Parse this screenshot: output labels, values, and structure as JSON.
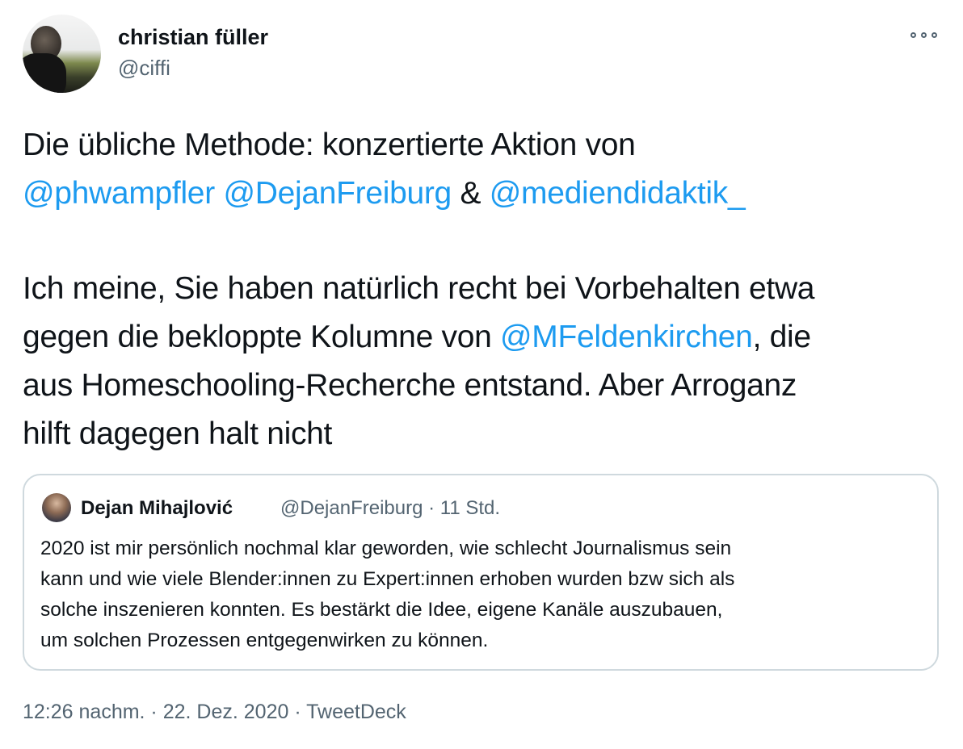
{
  "author": {
    "name": "christian füller",
    "handle": "@ciffi"
  },
  "tweet": {
    "lines": [
      [
        {
          "t": "Die übliche Methode: konzertierte Aktion von"
        }
      ],
      [
        {
          "t": "@phwampfler",
          "m": true
        },
        {
          "t": " "
        },
        {
          "t": "@DejanFreiburg",
          "m": true
        },
        {
          "t": " & "
        },
        {
          "t": "@mediendidaktik_",
          "m": true
        }
      ],
      [],
      [
        {
          "t": "Ich meine, Sie haben natürlich recht bei Vorbehalten etwa"
        }
      ],
      [
        {
          "t": "gegen die bekloppte Kolumne von "
        },
        {
          "t": "@MFeldenkirchen",
          "m": true
        },
        {
          "t": ", die"
        }
      ],
      [
        {
          "t": "aus Homeschooling-Recherche entstand. Aber Arroganz"
        }
      ],
      [
        {
          "t": "hilft dagegen halt nicht"
        }
      ]
    ]
  },
  "quote": {
    "name": "Dejan Mihajlović",
    "handle_time": "@DejanFreiburg · 11 Std.",
    "lines": [
      "2020 ist mir persönlich nochmal klar geworden, wie schlecht Journalismus sein",
      "kann und wie viele Blender:innen zu Expert:innen erhoben wurden bzw sich als",
      "solche inszenieren konnten. Es bestärkt die Idee, eigene Kanäle auszubauen,",
      "um solchen Prozessen entgegenwirken zu können."
    ]
  },
  "meta": {
    "text": "12:26 nachm. · 22. Dez. 2020 · TweetDeck"
  },
  "colors": {
    "link": "#1d9bf0",
    "secondary": "#536471",
    "border": "#cfd9de"
  },
  "icons": {
    "more": "more-horizontal-icon"
  }
}
